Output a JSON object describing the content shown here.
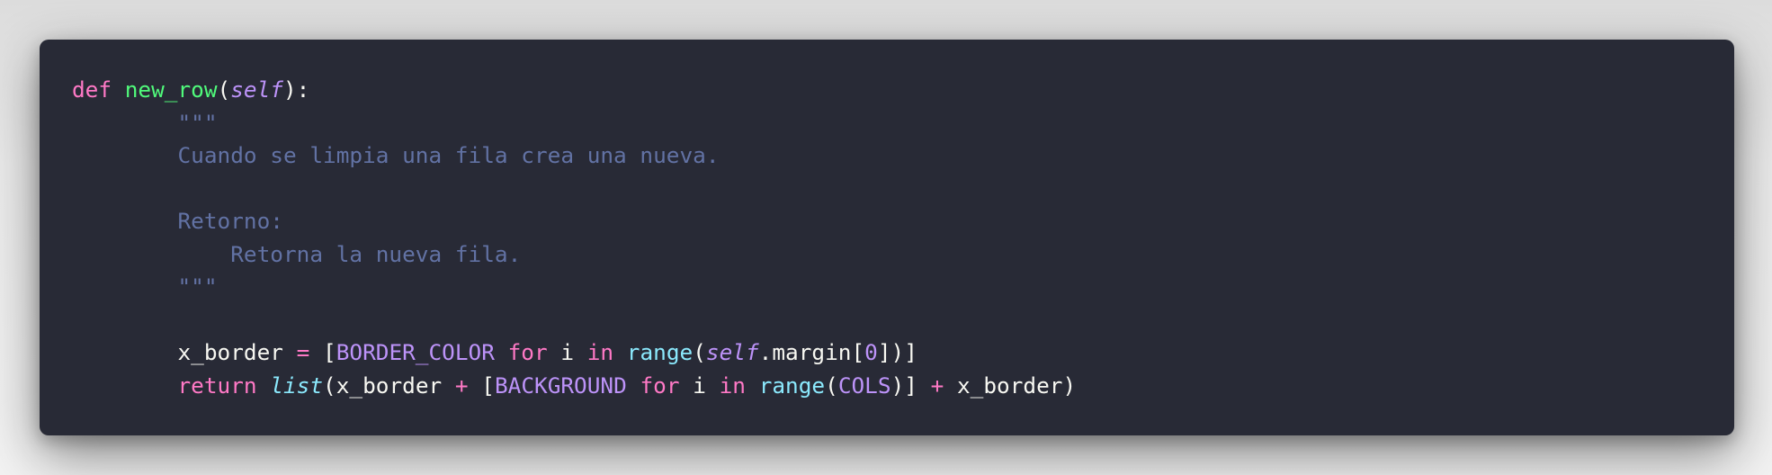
{
  "code": {
    "lines": [
      {
        "tokens": [
          {
            "text": "def",
            "type": "kw"
          },
          {
            "text": " ",
            "type": "plain"
          },
          {
            "text": "new_row",
            "type": "fn"
          },
          {
            "text": "(",
            "type": "plain"
          },
          {
            "text": "self",
            "type": "param"
          },
          {
            "text": "):",
            "type": "plain"
          }
        ]
      },
      {
        "tokens": [
          {
            "text": "        \"\"\"",
            "type": "doc"
          }
        ]
      },
      {
        "tokens": [
          {
            "text": "        Cuando se limpia una fila crea una nueva.",
            "type": "doc"
          }
        ]
      },
      {
        "tokens": [
          {
            "text": "",
            "type": "doc"
          }
        ]
      },
      {
        "tokens": [
          {
            "text": "        Retorno:",
            "type": "doc"
          }
        ]
      },
      {
        "tokens": [
          {
            "text": "            Retorna la nueva fila.",
            "type": "doc"
          }
        ]
      },
      {
        "tokens": [
          {
            "text": "        \"\"\"",
            "type": "doc"
          }
        ]
      },
      {
        "tokens": [
          {
            "text": "",
            "type": "plain"
          }
        ]
      },
      {
        "tokens": [
          {
            "text": "        x_border ",
            "type": "plain"
          },
          {
            "text": "=",
            "type": "op"
          },
          {
            "text": " [",
            "type": "plain"
          },
          {
            "text": "BORDER_COLOR",
            "type": "const"
          },
          {
            "text": " ",
            "type": "plain"
          },
          {
            "text": "for",
            "type": "kw"
          },
          {
            "text": " i ",
            "type": "plain"
          },
          {
            "text": "in",
            "type": "kw"
          },
          {
            "text": " ",
            "type": "plain"
          },
          {
            "text": "range",
            "type": "builtin"
          },
          {
            "text": "(",
            "type": "plain"
          },
          {
            "text": "self",
            "type": "param"
          },
          {
            "text": ".margin[",
            "type": "plain"
          },
          {
            "text": "0",
            "type": "num"
          },
          {
            "text": "])]",
            "type": "plain"
          }
        ]
      },
      {
        "tokens": [
          {
            "text": "        ",
            "type": "plain"
          },
          {
            "text": "return",
            "type": "kw"
          },
          {
            "text": " ",
            "type": "plain"
          },
          {
            "text": "list",
            "type": "builtin-it"
          },
          {
            "text": "(x_border ",
            "type": "plain"
          },
          {
            "text": "+",
            "type": "op"
          },
          {
            "text": " [",
            "type": "plain"
          },
          {
            "text": "BACKGROUND",
            "type": "const"
          },
          {
            "text": " ",
            "type": "plain"
          },
          {
            "text": "for",
            "type": "kw"
          },
          {
            "text": " i ",
            "type": "plain"
          },
          {
            "text": "in",
            "type": "kw"
          },
          {
            "text": " ",
            "type": "plain"
          },
          {
            "text": "range",
            "type": "builtin"
          },
          {
            "text": "(",
            "type": "plain"
          },
          {
            "text": "COLS",
            "type": "const"
          },
          {
            "text": ")] ",
            "type": "plain"
          },
          {
            "text": "+",
            "type": "op"
          },
          {
            "text": " x_border)",
            "type": "plain"
          }
        ]
      }
    ]
  },
  "theme": {
    "background": "#282a36",
    "foreground": "#f8f8f2",
    "keyword": "#ff79c6",
    "function": "#50fa7b",
    "parameter": "#bd93f9",
    "comment": "#6272a4",
    "builtin": "#8be9fd"
  }
}
